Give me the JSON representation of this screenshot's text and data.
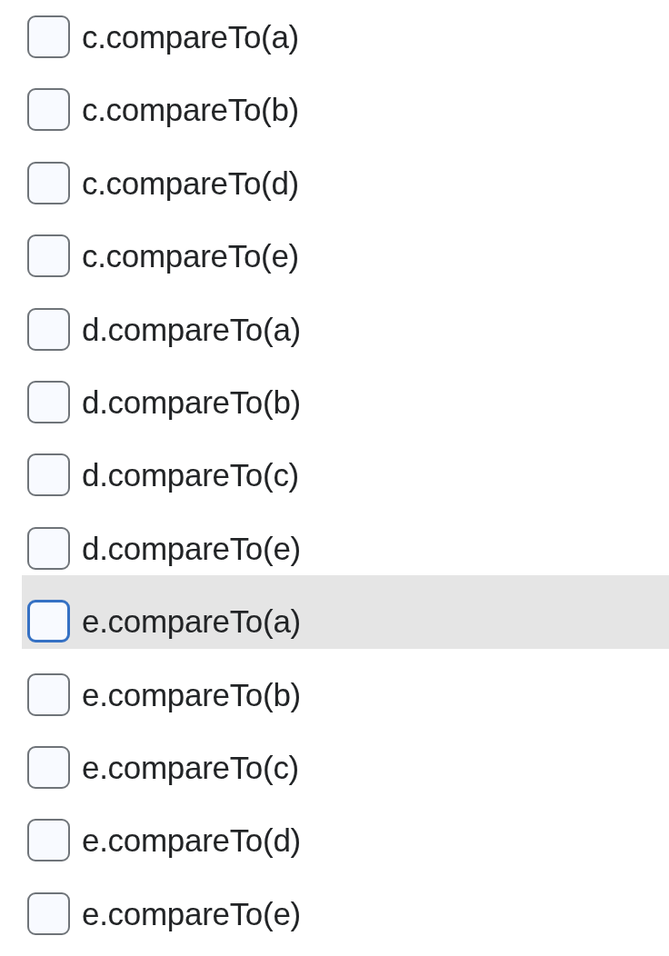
{
  "options": [
    {
      "label": "c.compareTo(a)",
      "checked": false,
      "highlighted": false
    },
    {
      "label": "c.compareTo(b)",
      "checked": false,
      "highlighted": false
    },
    {
      "label": "c.compareTo(d)",
      "checked": false,
      "highlighted": false
    },
    {
      "label": "c.compareTo(e)",
      "checked": false,
      "highlighted": false
    },
    {
      "label": "d.compareTo(a)",
      "checked": false,
      "highlighted": false
    },
    {
      "label": "d.compareTo(b)",
      "checked": false,
      "highlighted": false
    },
    {
      "label": "d.compareTo(c)",
      "checked": false,
      "highlighted": false
    },
    {
      "label": "d.compareTo(e)",
      "checked": false,
      "highlighted": false
    },
    {
      "label": "e.compareTo(a)",
      "checked": false,
      "highlighted": true
    },
    {
      "label": "e.compareTo(b)",
      "checked": false,
      "highlighted": false
    },
    {
      "label": "e.compareTo(c)",
      "checked": false,
      "highlighted": false
    },
    {
      "label": "e.compareTo(d)",
      "checked": false,
      "highlighted": false
    },
    {
      "label": "e.compareTo(e)",
      "checked": false,
      "highlighted": false
    }
  ]
}
